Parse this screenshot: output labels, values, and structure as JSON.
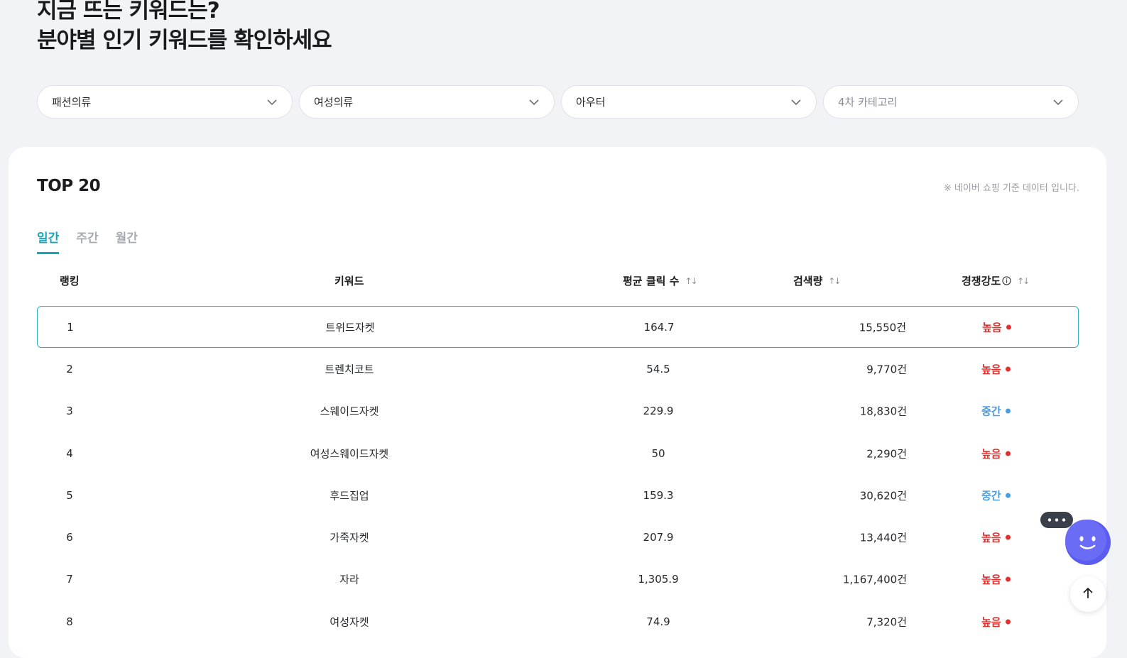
{
  "headline": {
    "line1": "지금 뜨는 키워드는?",
    "line2": "분야별 인기 키워드를 확인하세요"
  },
  "filters": [
    {
      "value": "패션의류",
      "placeholder": false
    },
    {
      "value": "여성의류",
      "placeholder": false
    },
    {
      "value": "아우터",
      "placeholder": false
    },
    {
      "value": "4차 카테고리",
      "placeholder": true
    }
  ],
  "card": {
    "title": "TOP 20",
    "note": "※ 네이버 쇼핑 기준 데이터 입니다."
  },
  "tabs": [
    {
      "label": "일간",
      "active": true
    },
    {
      "label": "주간",
      "active": false
    },
    {
      "label": "월간",
      "active": false
    }
  ],
  "table": {
    "headers": {
      "rank": "랭킹",
      "keyword": "키워드",
      "clicks": "평균 클릭 수",
      "search": "검색량",
      "competition": "경쟁강도"
    },
    "rows": [
      {
        "rank": "1",
        "keyword": "트위드자켓",
        "clicks": "164.7",
        "search": "15,550건",
        "competition": "높음",
        "level": "high"
      },
      {
        "rank": "2",
        "keyword": "트렌치코트",
        "clicks": "54.5",
        "search": "9,770건",
        "competition": "높음",
        "level": "high"
      },
      {
        "rank": "3",
        "keyword": "스웨이드자켓",
        "clicks": "229.9",
        "search": "18,830건",
        "competition": "중간",
        "level": "mid"
      },
      {
        "rank": "4",
        "keyword": "여성스웨이드자켓",
        "clicks": "50",
        "search": "2,290건",
        "competition": "높음",
        "level": "high"
      },
      {
        "rank": "5",
        "keyword": "후드집업",
        "clicks": "159.3",
        "search": "30,620건",
        "competition": "중간",
        "level": "mid"
      },
      {
        "rank": "6",
        "keyword": "가죽자켓",
        "clicks": "207.9",
        "search": "13,440건",
        "competition": "높음",
        "level": "high"
      },
      {
        "rank": "7",
        "keyword": "자라",
        "clicks": "1,305.9",
        "search": "1,167,400건",
        "competition": "높음",
        "level": "high"
      },
      {
        "rank": "8",
        "keyword": "여성자켓",
        "clicks": "74.9",
        "search": "7,320건",
        "competition": "높음",
        "level": "high"
      }
    ]
  },
  "colors": {
    "accent": "#16a6b8",
    "high": "#e0312f",
    "mid": "#4a9de0",
    "chatbot": "#5b5cf0"
  },
  "icons": {
    "select": "chevron-down-icon",
    "sort": "sort-arrows-icon",
    "info": "info-icon",
    "chatbot": "chatbot-face-icon",
    "top": "arrow-up-icon"
  }
}
